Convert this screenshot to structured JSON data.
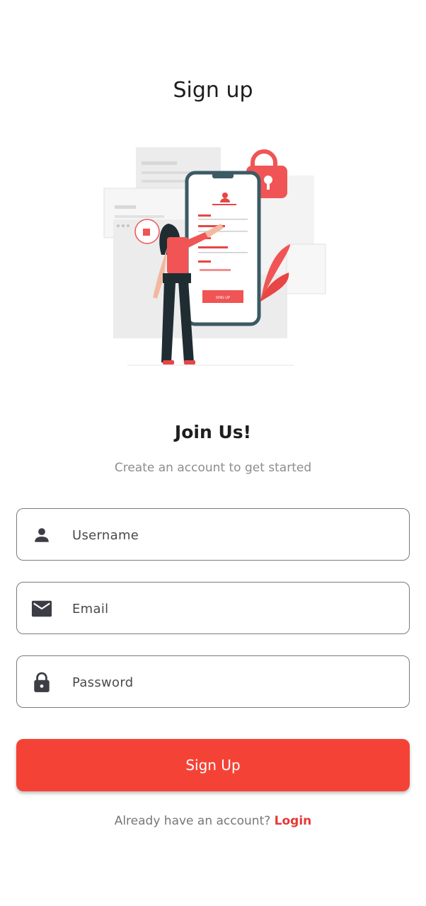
{
  "header": {
    "title": "Sign up"
  },
  "illustration": {
    "phone_button_label": "SING UP"
  },
  "intro": {
    "heading": "Join Us!",
    "subtitle": "Create an account to get started"
  },
  "form": {
    "username": {
      "placeholder": "Username",
      "value": "",
      "icon": "person-icon"
    },
    "email": {
      "placeholder": "Email",
      "value": "",
      "icon": "mail-icon"
    },
    "password": {
      "placeholder": "Password",
      "value": "",
      "icon": "lock-icon"
    }
  },
  "actions": {
    "signup_label": "Sign Up"
  },
  "footer": {
    "prompt": "Already have an account?",
    "login_label": "Login"
  },
  "colors": {
    "accent": "#f44336",
    "text": "#1d1d1f",
    "muted": "#8d8d92",
    "border": "#7b7b80",
    "icon": "#3d3d45"
  }
}
